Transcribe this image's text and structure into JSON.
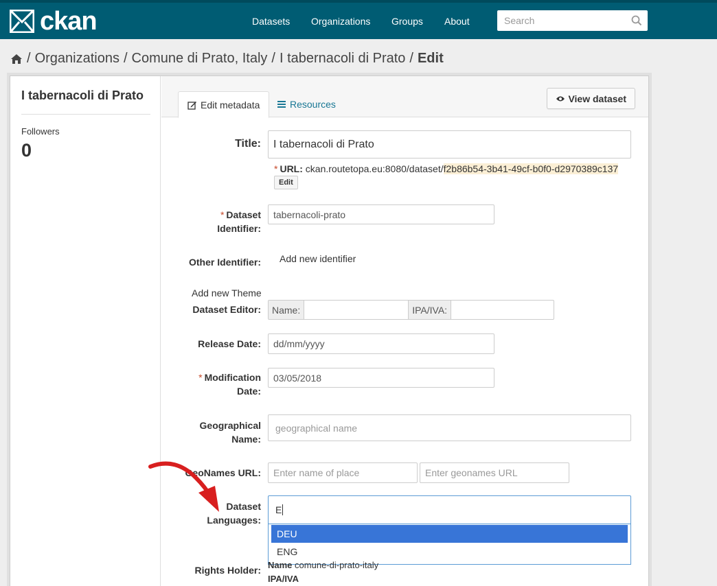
{
  "header": {
    "logo_text": "ckan",
    "nav": [
      "Datasets",
      "Organizations",
      "Groups",
      "About"
    ],
    "search_placeholder": "Search"
  },
  "breadcrumb": {
    "items": [
      "Organizations",
      "Comune di Prato, Italy",
      "I tabernacoli di Prato"
    ],
    "active": "Edit"
  },
  "sidebar": {
    "title": "I tabernacoli di Prato",
    "followers_label": "Followers",
    "followers_count": "0"
  },
  "tabs": {
    "edit_metadata": "Edit metadata",
    "resources": "Resources",
    "view_dataset": "View dataset"
  },
  "form": {
    "title_label": "Title:",
    "title_value": "I tabernacoli di Prato",
    "url_label": "URL:",
    "url_base": "ckan.routetopa.eu:8080/dataset/",
    "url_slug": "f2b86b54-3b41-49cf-b0f0-d2970389c137",
    "url_edit": "Edit",
    "identifier_label_1": "Dataset",
    "identifier_label_2": "Identifier:",
    "identifier_value": "tabernacoli-prato",
    "other_identifier_label": "Other Identifier:",
    "add_identifier": "Add new identifier",
    "add_theme": "Add new Theme",
    "editor_label": "Dataset Editor:",
    "editor_name_addon": "Name:",
    "editor_vat_addon": "IPA/IVA:",
    "release_label": "Release Date:",
    "release_placeholder": "dd/mm/yyyy",
    "modification_label_1": "Modification",
    "modification_label_2": "Date:",
    "modification_value": "03/05/2018",
    "geo_label_1": "Geographical",
    "geo_label_2": "Name:",
    "geo_placeholder": "geographical name",
    "geonames_label": "GeoNames URL:",
    "geonames_place_placeholder": "Enter name of place",
    "geonames_url_placeholder": "Enter geonames URL",
    "languages_label_1": "Dataset",
    "languages_label_2": "Languages:",
    "languages_typed": "E",
    "language_options": [
      "DEU",
      "ENG"
    ],
    "rights_label": "Rights Holder:",
    "rights_name_key": "Name",
    "rights_name_value": "comune-di-prato-italy",
    "rights_vat_key": "IPA/IVA"
  },
  "colors": {
    "header_bg": "#005c73",
    "link": "#187794",
    "highlight": "#3875d7",
    "arrow": "#d81f1f"
  }
}
